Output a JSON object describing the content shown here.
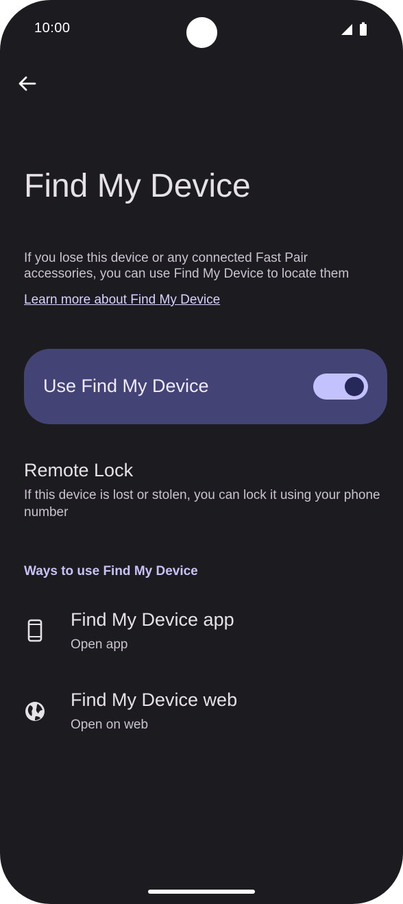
{
  "status_bar": {
    "time": "10:00",
    "icons": [
      "signal-icon",
      "battery-icon"
    ]
  },
  "toolbar": {
    "back_icon": "arrow-back-icon"
  },
  "page": {
    "title": "Find My Device",
    "description": "If you lose this device or any connected Fast Pair accessories, you can use Find My Device to locate them",
    "learn_more_link": "Learn more about Find My Device"
  },
  "main_switch": {
    "label": "Use Find My Device",
    "enabled": true
  },
  "remote_lock": {
    "title": "Remote Lock",
    "summary": "If this device is lost or stolen, you can lock it using your phone number"
  },
  "ways_section": {
    "header": "Ways to use Find My Device",
    "items": [
      {
        "icon": "phone-icon",
        "title": "Find My Device app",
        "subtitle": "Open app"
      },
      {
        "icon": "globe-icon",
        "title": "Find My Device web",
        "subtitle": "Open on web"
      }
    ]
  },
  "colors": {
    "background": "#1c1b20",
    "switch_bar": "#434475",
    "toggle_track": "#c4c1ff",
    "toggle_thumb": "#27285a",
    "accent_text": "#c7c2f5"
  }
}
